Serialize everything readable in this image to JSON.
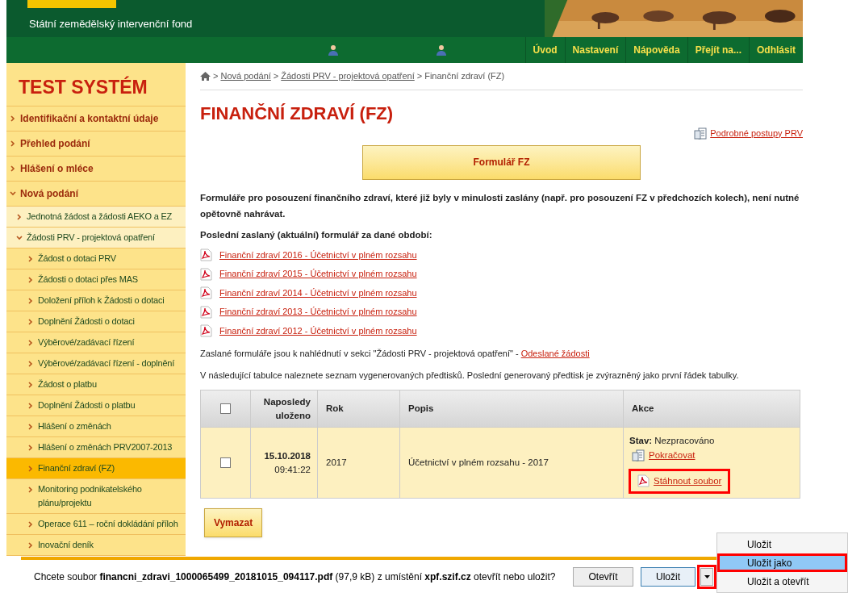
{
  "header": {
    "org_name": "Státní zemědělský intervenční fond"
  },
  "nav": {
    "items": [
      "Úvod",
      "Nastavení",
      "Nápověda",
      "Přejít na...",
      "Odhlásit"
    ]
  },
  "sidebar": {
    "title": "TEST SYSTÉM",
    "items": [
      {
        "label": "Identifikační a kontaktní údaje",
        "expanded": false,
        "selected": false
      },
      {
        "label": "Přehled podání",
        "expanded": false,
        "selected": false
      },
      {
        "label": "Hlášení o mléce",
        "expanded": false,
        "selected": false
      },
      {
        "label": "Nová podání",
        "expanded": true,
        "selected": false,
        "children": [
          {
            "label": "Jednotná žádost a žádosti AEKO a EZ",
            "expanded": false,
            "selected": false
          },
          {
            "label": "Žádosti PRV - projektová opatření",
            "expanded": true,
            "selected": false,
            "children": [
              {
                "label": "Žádost o dotaci PRV",
                "expanded": false,
                "selected": false
              },
              {
                "label": "Žádosti o dotaci přes MAS",
                "expanded": false,
                "selected": false
              },
              {
                "label": "Doložení příloh k Žádosti o dotaci",
                "expanded": false,
                "selected": false
              },
              {
                "label": "Doplnění Žádosti o dotaci",
                "expanded": false,
                "selected": false
              },
              {
                "label": "Výběrové/zadávací řízení",
                "expanded": false,
                "selected": false
              },
              {
                "label": "Výběrové/zadávací řízení - doplnění",
                "expanded": false,
                "selected": false
              },
              {
                "label": "Žádost o platbu",
                "expanded": false,
                "selected": false
              },
              {
                "label": "Doplnění Žádosti o platbu",
                "expanded": false,
                "selected": false
              },
              {
                "label": "Hlášení o změnách",
                "expanded": false,
                "selected": false
              },
              {
                "label": "Hlášení o změnách PRV2007-2013",
                "expanded": false,
                "selected": false
              },
              {
                "label": "Finanční zdraví (FZ)",
                "expanded": false,
                "selected": true
              },
              {
                "label": "Monitoring podnikatelského plánu/projektu",
                "expanded": false,
                "selected": false
              },
              {
                "label": "Operace 611 – roční dokládání příloh",
                "expanded": false,
                "selected": false
              },
              {
                "label": "Inovační deník",
                "expanded": false,
                "selected": false
              }
            ]
          }
        ]
      }
    ]
  },
  "breadcrumb": [
    {
      "separator": ">",
      "label": "Nová podání",
      "kind": "link"
    },
    {
      "separator": ">",
      "label": "Žádosti PRV - projektová opatření",
      "kind": "link"
    },
    {
      "separator": ">",
      "label": "Finanční zdraví (FZ)",
      "kind": "current"
    }
  ],
  "page": {
    "title": "FINANČNÍ ZDRAVÍ (FZ)",
    "help_link": "Podrobné postupy PRV",
    "form_button": "Formulář FZ",
    "intro": "Formuláře pro posouzení finančního zdraví, které již byly v minulosti zaslány (např. pro posouzení FZ v předchozích kolech), není nutné opětovně nahrávat.",
    "last_sent_label": "Poslední zaslaný (aktuální) formulář za dané období:",
    "documents": [
      "Finanční zdraví 2016 - Účetnictví v plném rozsahu",
      "Finanční zdraví 2015 - Účetnictví v plném rozsahu",
      "Finanční zdraví 2014 - Účetnictví v plném rozsahu",
      "Finanční zdraví 2013 - Účetnictví v plném rozsahu",
      "Finanční zdraví 2012 - Účetnictví v plném rozsahu"
    ],
    "sent_note": "Zaslané formuláře jsou k nahlédnutí v sekci \"Žádosti PRV - projektová opatření\" - ",
    "sent_link": "Odeslané žádosti",
    "table_note": "V následující tabulce naleznete seznam vygenerovaných předtisků. Poslední generovaný předtisk je zvýrazněný jako první řádek tabulky."
  },
  "table": {
    "select_all": false,
    "columns": [
      "Naposledy uloženo",
      "Rok",
      "Popis",
      "Akce"
    ],
    "rows": [
      {
        "checked": false,
        "date": "15.10.2018",
        "time": "09:41:22",
        "year": "2017",
        "description": "Účetnictví v plném rozsahu - 2017",
        "status_label": "Stav:",
        "status": "Nezpracováno",
        "continue_link": "Pokračovat",
        "download_link": "Stáhnout soubor",
        "download_highlighted": true
      }
    ]
  },
  "delete_button": "Vymazat",
  "download_bar": {
    "prefix": "Chcete soubor ",
    "file": "financni_zdravi_1000065499_20181015_094117.pdf",
    "middle": " (97,9 kB) z umístění ",
    "site": "xpf.szif.cz",
    "suffix": " otevřít nebo uložit?",
    "open_button": "Otevřít",
    "save_button": "Uložit",
    "arrow_highlighted": true
  },
  "save_menu": [
    {
      "label": "Uložit",
      "selected": false,
      "highlighted": false
    },
    {
      "label": "Uložit jako",
      "selected": true,
      "highlighted": true
    },
    {
      "label": "Uložit a otevřít",
      "selected": false,
      "highlighted": false
    }
  ]
}
